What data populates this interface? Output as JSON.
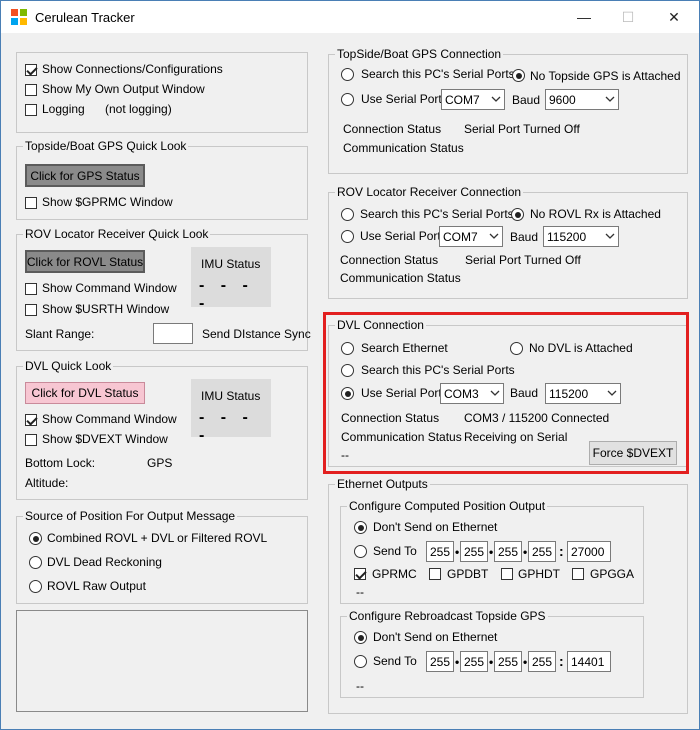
{
  "window": {
    "title": "Cerulean Tracker",
    "minimize": "—",
    "maximize": "☐",
    "close": "✕"
  },
  "options": {
    "show_connections": "Show Connections/Configurations",
    "show_output_window": "Show My Own Output Window",
    "logging": "Logging",
    "logging_status": "(not logging)"
  },
  "gps_quick": {
    "title": "Topside/Boat GPS Quick Look",
    "button": "Click for GPS Status",
    "show_window": "Show $GPRMC Window"
  },
  "rovl_quick": {
    "title": "ROV Locator Receiver Quick Look",
    "button": "Click for ROVL Status",
    "imu_label": "IMU Status",
    "imu_value": "- - - -",
    "show_command": "Show Command Window",
    "show_window": "Show $USRTH Window",
    "slant_label": "Slant Range:",
    "slant_value": "",
    "send_distance": "Send DIstance Sync"
  },
  "dvl_quick": {
    "title": "DVL Quick Look",
    "button": "Click for DVL Status",
    "imu_label": "IMU Status",
    "imu_value": "- - - -",
    "show_command": "Show Command Window",
    "show_window": "Show $DVEXT Window",
    "bottom_lock": "Bottom Lock:",
    "gps": "GPS",
    "altitude": "Altitude:"
  },
  "position_source": {
    "title": "Source of Position For Output Message",
    "options": [
      "Combined ROVL + DVL or Filtered ROVL",
      "DVL Dead Reckoning",
      "ROVL Raw Output"
    ]
  },
  "gps_conn": {
    "title": "TopSide/Boat GPS Connection",
    "search": "Search this PC's Serial Ports",
    "none": "No Topside GPS is Attached",
    "use_port": "Use Serial Port",
    "port": "COM7",
    "baud_label": "Baud",
    "baud": "9600",
    "conn_status_label": "Connection Status",
    "conn_status": "Serial Port Turned Off",
    "comm_status_label": "Communication Status"
  },
  "rovl_conn": {
    "title": "ROV Locator Receiver Connection",
    "search": "Search this PC's Serial Ports",
    "none": "No ROVL Rx is Attached",
    "use_port": "Use Serial Port",
    "port": "COM7",
    "baud_label": "Baud",
    "baud": "115200",
    "conn_status_label": "Connection Status",
    "conn_status": "Serial Port Turned Off",
    "comm_status_label": "Communication Status"
  },
  "dvl_conn": {
    "title": "DVL Connection",
    "search_eth": "Search Ethernet",
    "none": "No DVL is Attached",
    "search": "Search this  PC's Serial Ports",
    "use_port": "Use Serial Port",
    "port": "COM3",
    "baud_label": "Baud",
    "baud": "115200",
    "conn_status_label": "Connection Status",
    "conn_status": "COM3 / 115200 Connected",
    "comm_status_label": "Communication Status",
    "comm_status": "Receiving on Serial",
    "extra": "--",
    "force_button": "Force $DVEXT"
  },
  "ethernet": {
    "title": "Ethernet Outputs",
    "computed": {
      "title": "Configure Computed Position Output",
      "dont_send": "Don't Send on Ethernet",
      "send_to": "Send To",
      "ip": [
        "255",
        "255",
        "255",
        "255"
      ],
      "port": "27000",
      "gprmc": "GPRMC",
      "gpdbt": "GPDBT",
      "gphdt": "GPHDT",
      "gpgga": "GPGGA",
      "extra": "--"
    },
    "rebroadcast": {
      "title": "Configure Rebroadcast Topside GPS",
      "dont_send": "Don't Send on Ethernet",
      "send_to": "Send To",
      "ip": [
        "255",
        "255",
        "255",
        "255"
      ],
      "port": "14401",
      "extra": "--"
    }
  },
  "highlight_color": "#e21f1f"
}
